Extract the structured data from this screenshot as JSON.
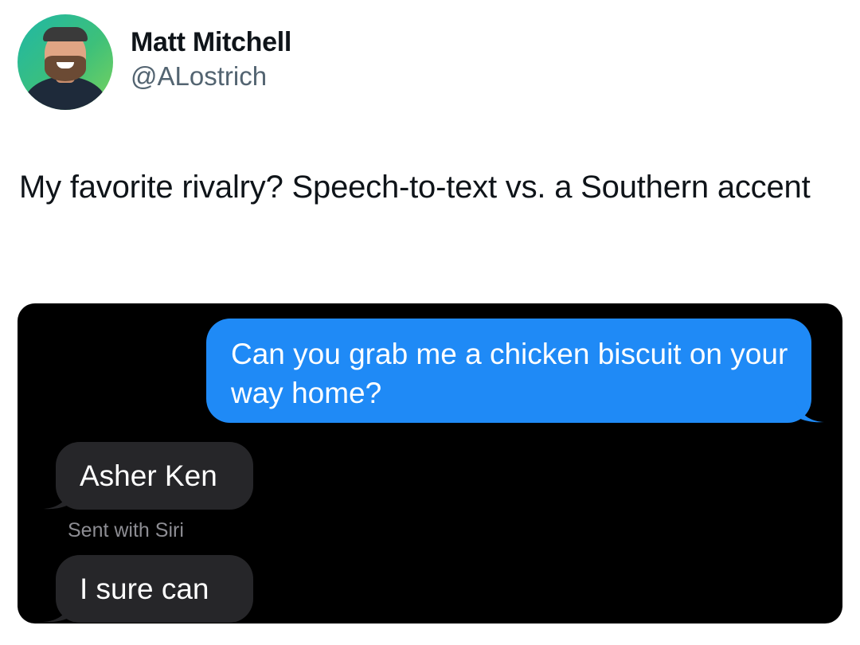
{
  "author": {
    "display_name": "Matt Mitchell",
    "handle": "@ALostrich"
  },
  "tweet": {
    "text": "My favorite rivalry? Speech-to-text vs. a Southern accent"
  },
  "messages": {
    "outgoing_1": "Can you grab me a chicken biscuit on your way home?",
    "incoming_1": "Asher Ken",
    "siri_note": "Sent with Siri",
    "incoming_2": "I sure can"
  },
  "colors": {
    "outgoing_bubble": "#1f8af6",
    "incoming_bubble": "#262629",
    "chat_background": "#000000",
    "handle_gray": "#536471"
  }
}
